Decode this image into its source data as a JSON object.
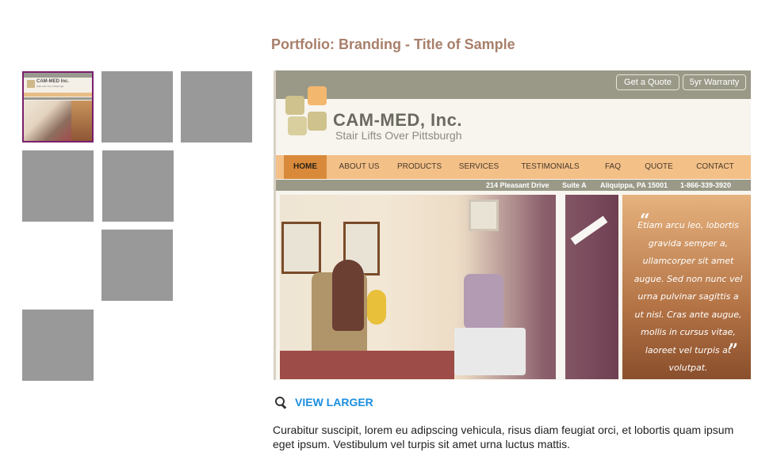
{
  "header": {
    "title": "Portfolio: Branding - Title of Sample"
  },
  "thumbnails": [
    {
      "id": "thumb-1",
      "active": true
    },
    {
      "id": "thumb-2",
      "active": false
    },
    {
      "id": "thumb-3",
      "active": false
    },
    {
      "id": "thumb-4",
      "active": false
    },
    {
      "id": "thumb-5",
      "active": false
    },
    {
      "id": "thumb-6",
      "active": false
    },
    {
      "id": "thumb-7",
      "active": false
    }
  ],
  "mini_preview": {
    "brand": "CAM-MED Inc.",
    "tagline": "Stair Lifts Over Pittsburgh"
  },
  "sample": {
    "top_buttons": [
      "Get a Quote",
      "5yr Warranty"
    ],
    "brand": "CAM-MED, Inc.",
    "tagline": "Stair Lifts Over Pittsburgh",
    "nav": [
      "HOME",
      "ABOUT US",
      "PRODUCTS",
      "SERVICES",
      "TESTIMONIALS",
      "FAQ",
      "QUOTE",
      "CONTACT"
    ],
    "nav_active": "HOME",
    "info": {
      "address": "214 Pleasant Drive",
      "suite": "Suite A",
      "city": "Aliquippa, PA 15001",
      "phone": "1-866-339-3920"
    },
    "quote_open": "“",
    "quote_close": "”",
    "quote": "Etiam arcu leo, lobortis gravida semper a, ullamcorper sit amet augue. Sed non nunc vel urna pulvinar sagittis a ut nisl. Cras ante augue, mollis in cursus vitae, laoreet vel turpis at volutpat."
  },
  "actions": {
    "view_larger": "VIEW LARGER"
  },
  "description": "Curabitur suscipit, lorem eu adipscing vehicula, risus diam feugiat orci, et lobortis quam ipsum eget ipsum. Vestibulum vel turpis sit amet urna luctus mattis.",
  "colors": {
    "title": "#a87f6a",
    "thumb_gray": "#999999",
    "active_border": "#7a1f6e",
    "link": "#1b8fe0",
    "nav_bg": "#f3c088",
    "nav_active": "#d9893a"
  }
}
